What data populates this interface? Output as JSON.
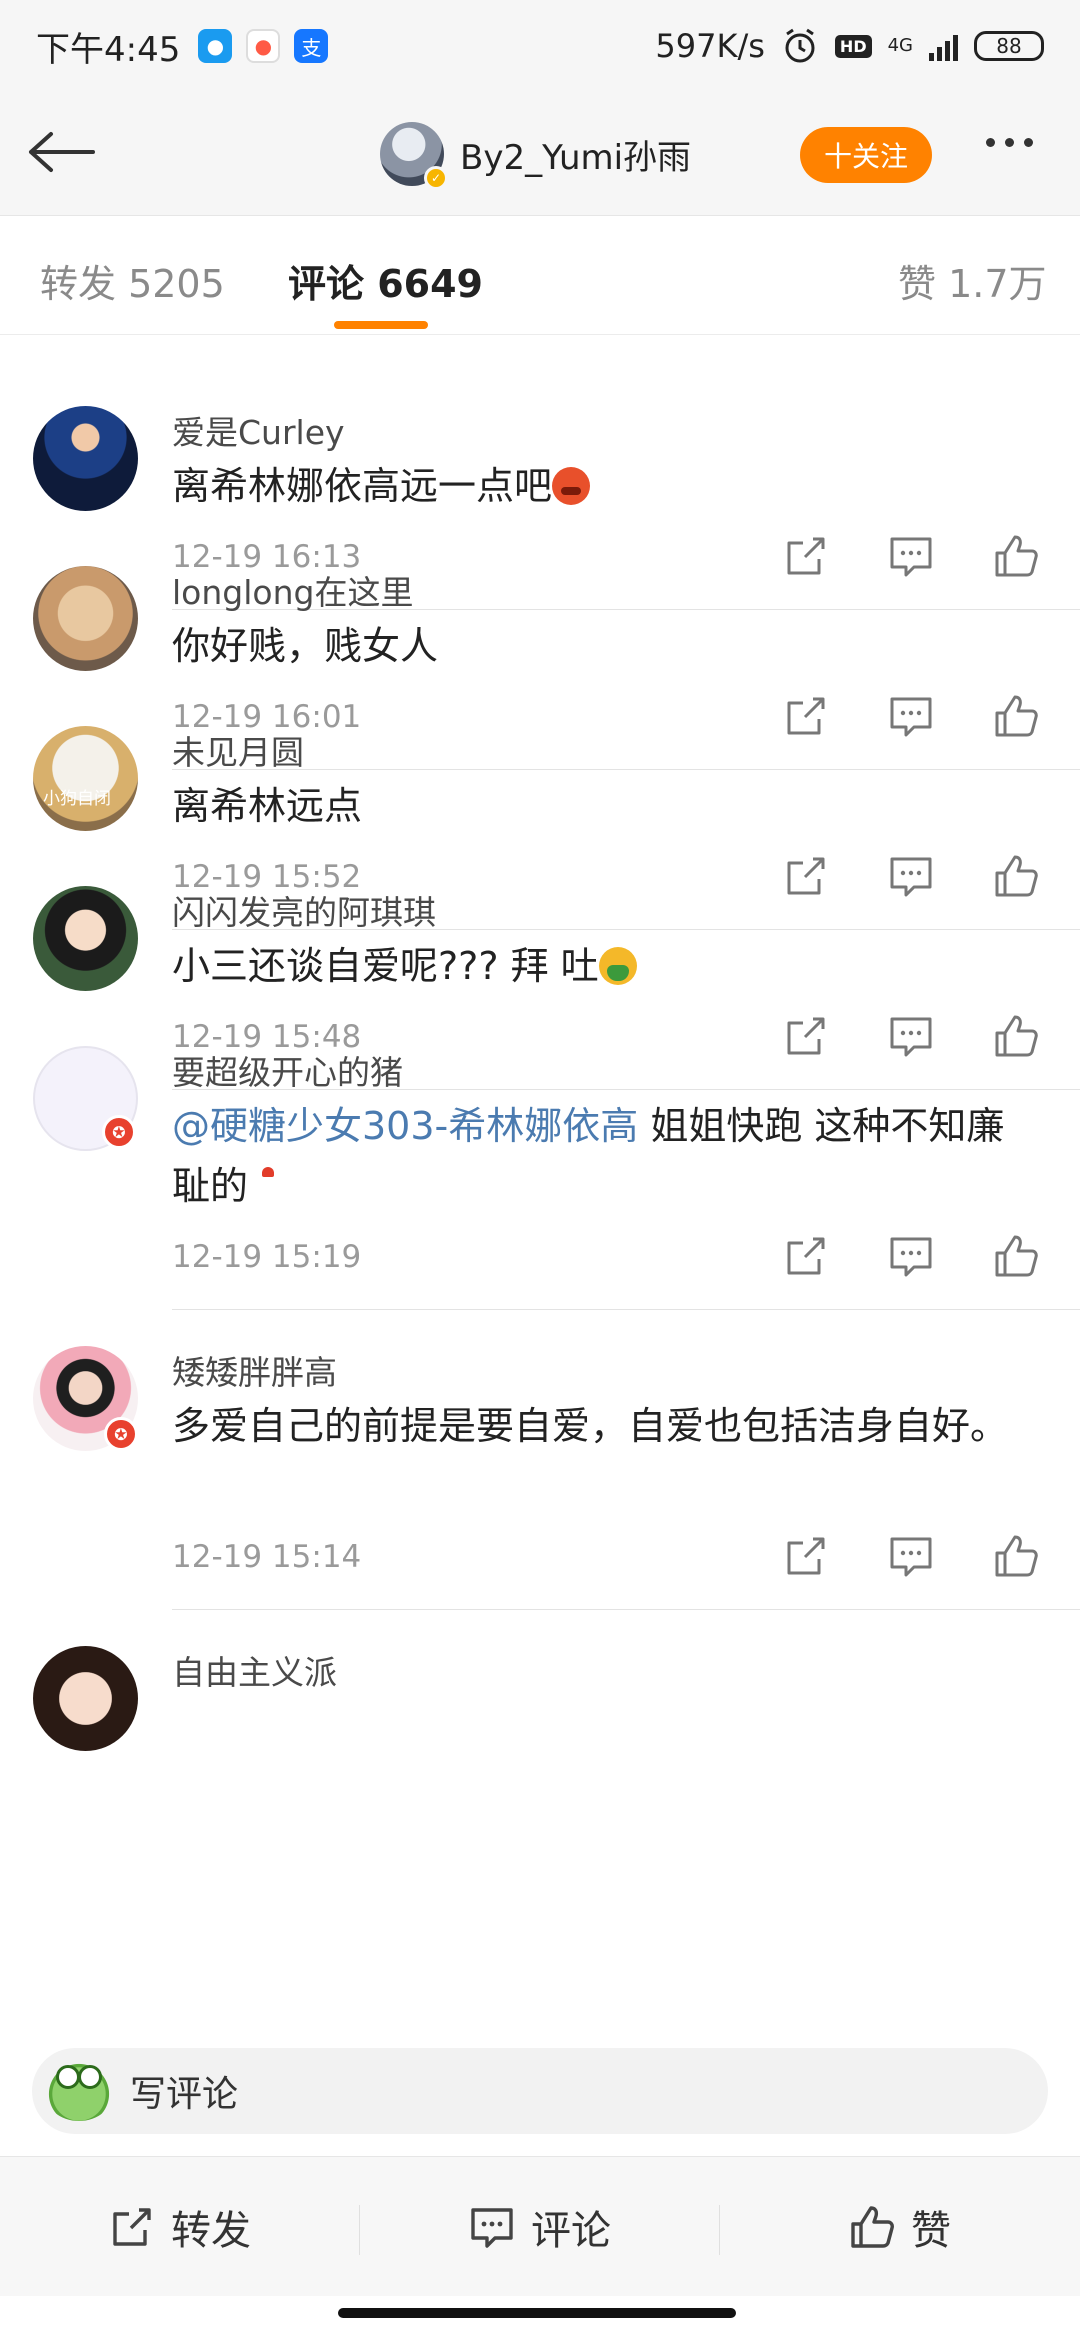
{
  "status_bar": {
    "time": "下午4:45",
    "network_speed": "597K/s",
    "hd_label": "HD",
    "network_type": "4G",
    "battery": "88",
    "apps": [
      {
        "icon": "qq-icon",
        "color": "#1a9bf0"
      },
      {
        "icon": "maps-icon",
        "color": "#ff5a45"
      },
      {
        "icon": "alipay-icon",
        "color": "#1677ff"
      }
    ]
  },
  "header": {
    "username": "By2_Yumi孙雨",
    "follow_label": "十关注",
    "accent_color": "#ff8200"
  },
  "tabs": {
    "repost": "转发 5205",
    "comments": "评论 6649",
    "likes": "赞 1.7万",
    "active": "comments"
  },
  "comments": [
    {
      "user": "爱是Curley",
      "text": "离希林娜依高远一点吧",
      "emoji": "angry-emoji",
      "time": "12-19 16:13",
      "badge": false
    },
    {
      "user": "longlong在这里",
      "text": "你好贱，贱女人",
      "emoji": "",
      "time": "12-19 16:01",
      "badge": false
    },
    {
      "user": "未见月圆",
      "text": "离希林远点",
      "emoji": "",
      "time": "12-19 15:52",
      "badge": false,
      "avatar_caption": "小狗自闭"
    },
    {
      "user": "闪闪发亮的阿琪琪",
      "text": "小三还谈自爱呢??? 拜 吐",
      "emoji": "vomit-emoji",
      "time": "12-19 15:48",
      "badge": false
    },
    {
      "user": "要超级开心的猪",
      "mention": "@硬糖少女303-希林娜依高",
      "text": " 姐姐快跑 这种不知廉耻的",
      "emoji": "chicken-emoji",
      "time": "12-19 15:19",
      "badge": true
    },
    {
      "user": "矮矮胖胖高",
      "text": "多爱自己的前提是要自爱，自爱也包括洁身自好。",
      "emoji": "",
      "time": "12-19 15:14",
      "badge": true
    },
    {
      "user": "自由主义派",
      "text": "",
      "emoji": "",
      "time": "",
      "badge": false
    }
  ],
  "write_comment": {
    "placeholder": "写评论"
  },
  "toolbar": {
    "repost_label": "转发",
    "comment_label": "评论",
    "like_label": "赞"
  }
}
